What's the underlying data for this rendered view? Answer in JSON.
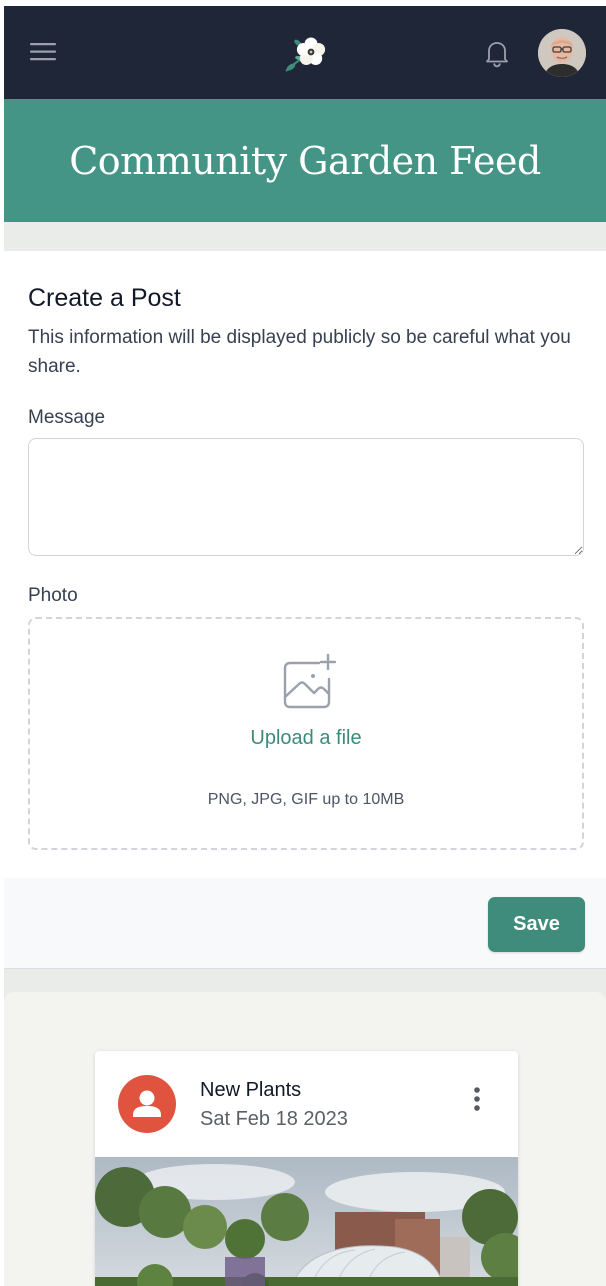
{
  "header": {
    "title": "Community Garden Feed",
    "icons": {
      "menu": "menu-icon",
      "logo": "flower-logo",
      "notifications": "bell-icon",
      "avatar": "user-avatar"
    }
  },
  "form": {
    "title": "Create a Post",
    "description": "This information will be displayed publicly so be careful what you share.",
    "message_label": "Message",
    "message_value": "",
    "photo_label": "Photo",
    "upload_link": "Upload a file",
    "upload_hint": "PNG, JPG, GIF up to 10MB",
    "save_label": "Save"
  },
  "feed": {
    "posts": [
      {
        "title": "New Plants",
        "date": "Sat Feb 18 2023"
      }
    ]
  },
  "colors": {
    "navbar": "#1f2638",
    "hero": "#449586",
    "accent": "#3f8c7d",
    "post_avatar": "#e0533f"
  }
}
